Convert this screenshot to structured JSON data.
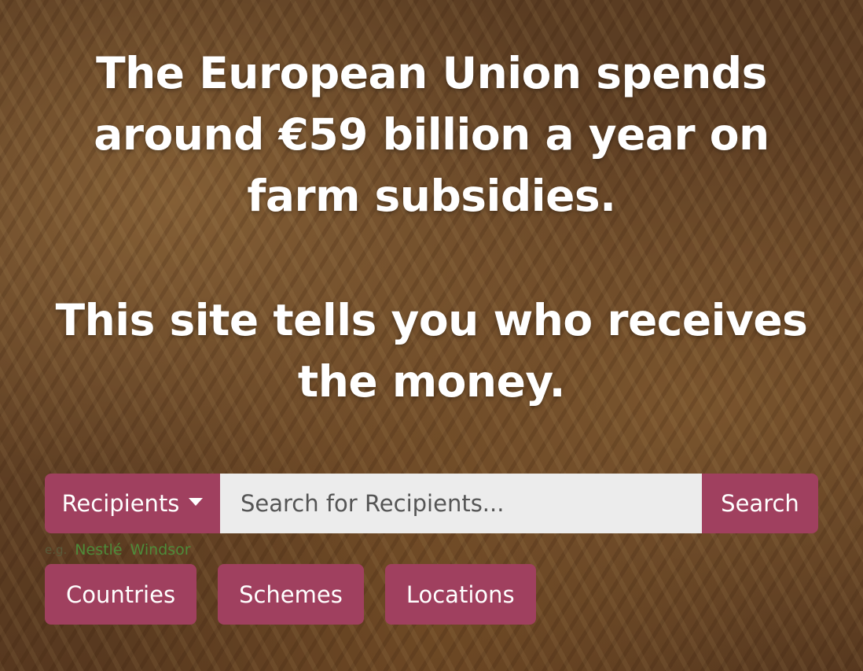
{
  "headline": {
    "line1": "The European Union spends around €59 billion a year on farm subsidies.",
    "line2": "This site tells you who receives the money."
  },
  "search": {
    "dropdown_label": "Recipients",
    "placeholder": "Search for Recipients...",
    "button_label": "Search"
  },
  "suggestions": {
    "prefix": "e.g.",
    "items": [
      "Nestlé",
      "Windsor"
    ]
  },
  "nav": {
    "countries": "Countries",
    "schemes": "Schemes",
    "locations": "Locations"
  },
  "colors": {
    "accent": "#a0405f",
    "input_bg": "#ececec",
    "suggestion_link": "#4e8b3a"
  }
}
